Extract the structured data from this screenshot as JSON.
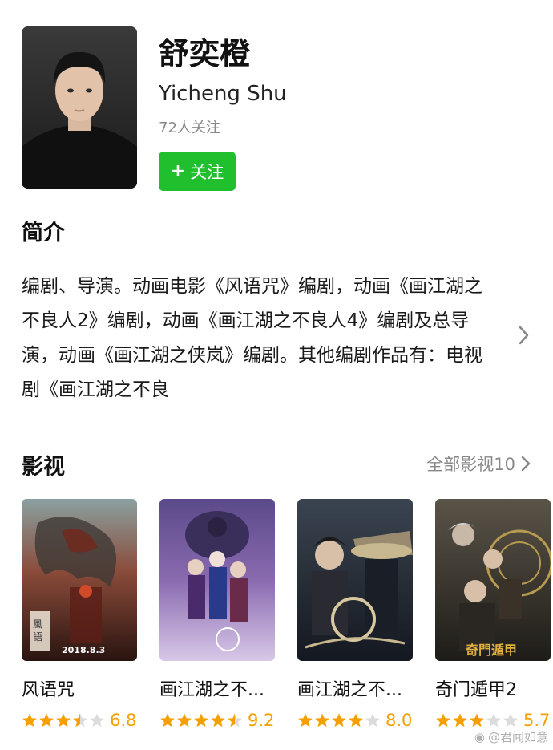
{
  "profile": {
    "name_cn": "舒奕橙",
    "name_en": "Yicheng Shu",
    "followers": "72人关注",
    "follow_label": "关注"
  },
  "intro": {
    "title": "简介",
    "text": "编剧、导演。动画电影《风语咒》编剧，动画《画江湖之不良人2》编剧，动画《画江湖之不良人4》编剧及总导演，动画《画江湖之侠岚》编剧。其他编剧作品有：电视剧《画江湖之不良"
  },
  "films": {
    "title": "影视",
    "all_label": "全部影视10",
    "items": [
      {
        "title": "风语咒",
        "rating": 3.5,
        "score": "6.8",
        "poster_text": "2018.8.3"
      },
      {
        "title": "画江湖之不...",
        "rating": 4.5,
        "score": "9.2"
      },
      {
        "title": "画江湖之不...",
        "rating": 4.0,
        "score": "8.0"
      },
      {
        "title": "奇门遁甲2",
        "rating": 3.0,
        "score": "5.7"
      }
    ]
  },
  "watermark": "@君闻如意",
  "colors": {
    "accent_green": "#1fbf2d",
    "star": "#f5a000",
    "star_empty": "#dcdcdc"
  }
}
